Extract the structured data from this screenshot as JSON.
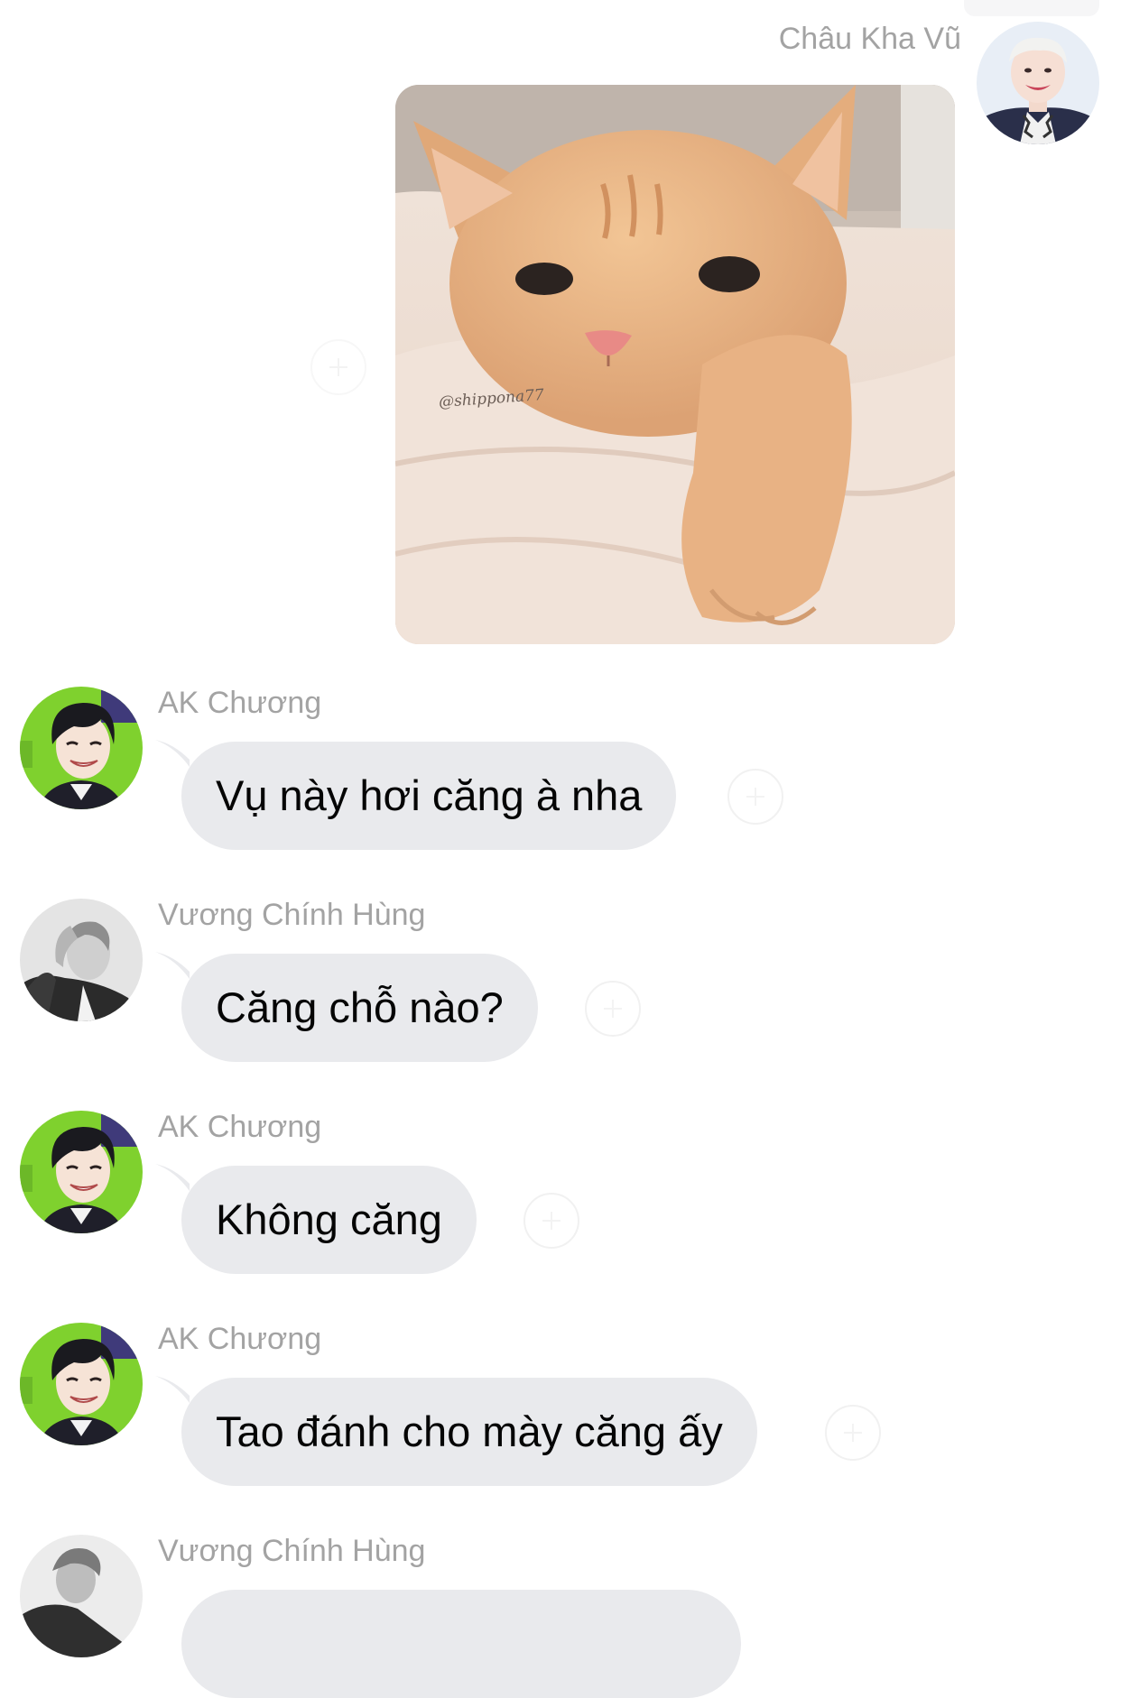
{
  "messages": [
    {
      "sender": "Châu Kha Vũ",
      "type": "image",
      "image_caption": "@shippona77"
    },
    {
      "sender": "AK Chương",
      "type": "text",
      "text": "Vụ này hơi căng à nha"
    },
    {
      "sender": "Vương Chính Hùng",
      "type": "text",
      "text": "Căng chỗ nào?"
    },
    {
      "sender": "AK Chương",
      "type": "text",
      "text": "Không căng"
    },
    {
      "sender": "AK Chương",
      "type": "text",
      "text": "Tao đánh cho mày căng ấy"
    },
    {
      "sender": "Vương Chính Hùng",
      "type": "text",
      "text": ""
    }
  ],
  "colors": {
    "bubble_bg": "#e9eaed",
    "name_text": "#a3a3a3",
    "message_text": "#050505",
    "ak_avatar_bg": "#7fd12e"
  },
  "icons": {
    "reaction": "add-reaction-icon"
  }
}
